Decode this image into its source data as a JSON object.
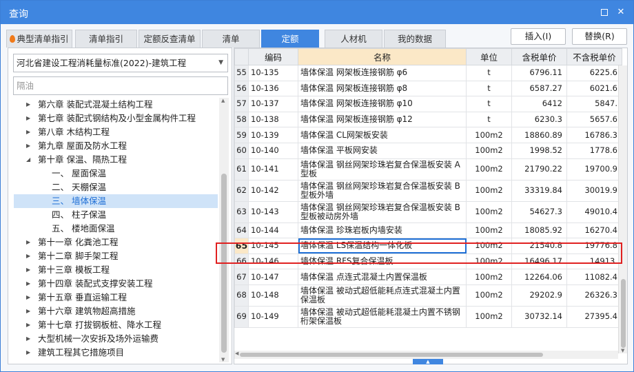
{
  "window": {
    "title": "查询"
  },
  "tabs": [
    {
      "label": "典型清单指引",
      "icon": "flame-icon"
    },
    {
      "label": "清单指引"
    },
    {
      "label": "定额反查清单"
    },
    {
      "label": "清单"
    },
    {
      "label": "定额",
      "active": true
    },
    {
      "label": "人材机"
    },
    {
      "label": "我的数据"
    }
  ],
  "actions": {
    "insert": "插入(I)",
    "replace": "替换(R)"
  },
  "left": {
    "standard": "河北省建设工程消耗量标准(2022)-建筑工程",
    "search_placeholder": "隔油",
    "tree": [
      {
        "label": "第六章 装配式混凝土结构工程",
        "level": 1,
        "state": "collapsed"
      },
      {
        "label": "第七章 装配式钢结构及小型金属构件工程",
        "level": 1,
        "state": "collapsed"
      },
      {
        "label": "第八章 木结构工程",
        "level": 1,
        "state": "collapsed"
      },
      {
        "label": "第九章 屋面及防水工程",
        "level": 1,
        "state": "collapsed"
      },
      {
        "label": "第十章 保温、隔热工程",
        "level": 1,
        "state": "expanded"
      },
      {
        "label": "一、 屋面保温",
        "level": 2
      },
      {
        "label": "二、 天棚保温",
        "level": 2
      },
      {
        "label": "三、 墙体保温",
        "level": 2,
        "selected": true
      },
      {
        "label": "四、 柱子保温",
        "level": 2
      },
      {
        "label": "五、 楼地面保温",
        "level": 2
      },
      {
        "label": "第十一章 化粪池工程",
        "level": 1,
        "state": "collapsed"
      },
      {
        "label": "第十二章 脚手架工程",
        "level": 1,
        "state": "collapsed"
      },
      {
        "label": "第十三章 模板工程",
        "level": 1,
        "state": "collapsed"
      },
      {
        "label": "第十四章 装配式支撑安装工程",
        "level": 1,
        "state": "collapsed"
      },
      {
        "label": "第十五章 垂直运输工程",
        "level": 1,
        "state": "collapsed"
      },
      {
        "label": "第十六章 建筑物超高措施",
        "level": 1,
        "state": "collapsed"
      },
      {
        "label": "第十七章 打拔钢板桩、降水工程",
        "level": 1,
        "state": "collapsed"
      },
      {
        "label": "大型机械一次安拆及场外运输费",
        "level": 1,
        "state": "collapsed"
      },
      {
        "label": "建筑工程其它措施项目",
        "level": 1,
        "state": "collapsed"
      }
    ]
  },
  "table": {
    "headers": [
      "编码",
      "名称",
      "单位",
      "含税单价",
      "不含税单价"
    ],
    "rows": [
      {
        "no": "55",
        "code": "10-135",
        "name": "墙体保温 网架板连接钢筋 φ6",
        "unit": "t",
        "price_tax": "6796.11",
        "price_notax": "6225.6"
      },
      {
        "no": "56",
        "code": "10-136",
        "name": "墙体保温 网架板连接钢筋 φ8",
        "unit": "t",
        "price_tax": "6587.27",
        "price_notax": "6021.6"
      },
      {
        "no": "57",
        "code": "10-137",
        "name": "墙体保温 网架板连接钢筋 φ10",
        "unit": "t",
        "price_tax": "6412",
        "price_notax": "5847."
      },
      {
        "no": "58",
        "code": "10-138",
        "name": "墙体保温 网架板连接钢筋 φ12",
        "unit": "t",
        "price_tax": "6230.3",
        "price_notax": "5657.6"
      },
      {
        "no": "59",
        "code": "10-139",
        "name": "墙体保温 CL网架板安装",
        "unit": "100m2",
        "price_tax": "18860.89",
        "price_notax": "16786.3"
      },
      {
        "no": "60",
        "code": "10-140",
        "name": "墙体保温 平板网安装",
        "unit": "100m2",
        "price_tax": "1998.52",
        "price_notax": "1778.6"
      },
      {
        "no": "61",
        "code": "10-141",
        "name": "墙体保温 钢丝网架珍珠岩复合保温板安装 A型板",
        "unit": "100m2",
        "price_tax": "21790.22",
        "price_notax": "19700.9"
      },
      {
        "no": "62",
        "code": "10-142",
        "name": "墙体保温 钢丝网架珍珠岩复合保温板安装 B型板外墙",
        "unit": "100m2",
        "price_tax": "33319.84",
        "price_notax": "30019.9"
      },
      {
        "no": "63",
        "code": "10-143",
        "name": "墙体保温 钢丝网架珍珠岩复合保温板安装 B型板被动房外墙",
        "unit": "100m2",
        "price_tax": "54627.3",
        "price_notax": "49010.4"
      },
      {
        "no": "64",
        "code": "10-144",
        "name": "墙体保温 珍珠岩板内墙安装",
        "unit": "100m2",
        "price_tax": "18085.92",
        "price_notax": "16270.4"
      },
      {
        "no": "65",
        "code": "10-145",
        "name": "墙体保温 LS保温结构一体化板",
        "unit": "100m2",
        "price_tax": "21540.8",
        "price_notax": "19776.8",
        "current": true
      },
      {
        "no": "66",
        "code": "10-146",
        "name": "墙体保温 RFS复合保温板",
        "unit": "100m2",
        "price_tax": "16496.17",
        "price_notax": "14913."
      },
      {
        "no": "67",
        "code": "10-147",
        "name": "墙体保温 点连式混凝土内置保温板",
        "unit": "100m2",
        "price_tax": "12264.06",
        "price_notax": "11082.4"
      },
      {
        "no": "68",
        "code": "10-148",
        "name": "墙体保温 被动式超低能耗点连式混凝土内置保温板",
        "unit": "100m2",
        "price_tax": "29202.9",
        "price_notax": "26326.3"
      },
      {
        "no": "69",
        "code": "10-149",
        "name": "墙体保温 被动式超低能耗混凝土内置不锈钢桁架保温板",
        "unit": "100m2",
        "price_tax": "30732.14",
        "price_notax": "27395.4"
      }
    ]
  },
  "colors": {
    "accent": "#3f86e0",
    "highlight_box": "#e02020",
    "selected_row_header": "#fbe8c7"
  }
}
